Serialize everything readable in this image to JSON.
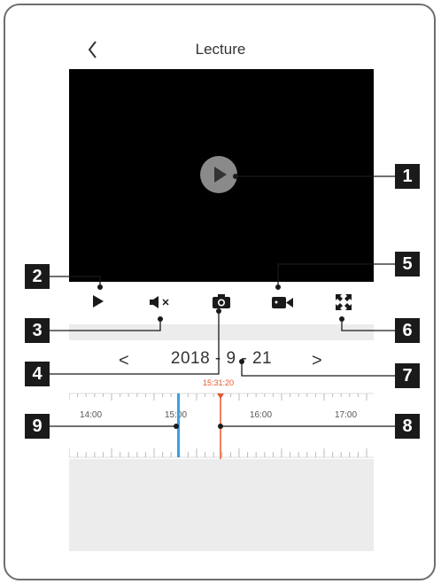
{
  "header": {
    "title": "Lecture",
    "back_icon": "chevron-left-icon"
  },
  "player": {
    "play_icon": "play-icon"
  },
  "toolbar": [
    {
      "name": "play-button",
      "icon": "play-icon"
    },
    {
      "name": "mute-button",
      "icon": "speaker-muted-icon"
    },
    {
      "name": "snapshot-button",
      "icon": "camera-icon"
    },
    {
      "name": "record-button",
      "icon": "video-camera-icon"
    },
    {
      "name": "fullscreen-button",
      "icon": "fullscreen-icon"
    }
  ],
  "date_nav": {
    "prev": "<",
    "date": "2018 - 9 - 21",
    "next": ">"
  },
  "timeline": {
    "current_time": "15:31:20",
    "labels": [
      "14:00",
      "15:00",
      "16:00",
      "17:00"
    ],
    "accent_color": "#e8562a",
    "recording_color": "#3aa0e8"
  },
  "callouts": [
    "1",
    "2",
    "3",
    "4",
    "5",
    "6",
    "7",
    "8",
    "9"
  ]
}
